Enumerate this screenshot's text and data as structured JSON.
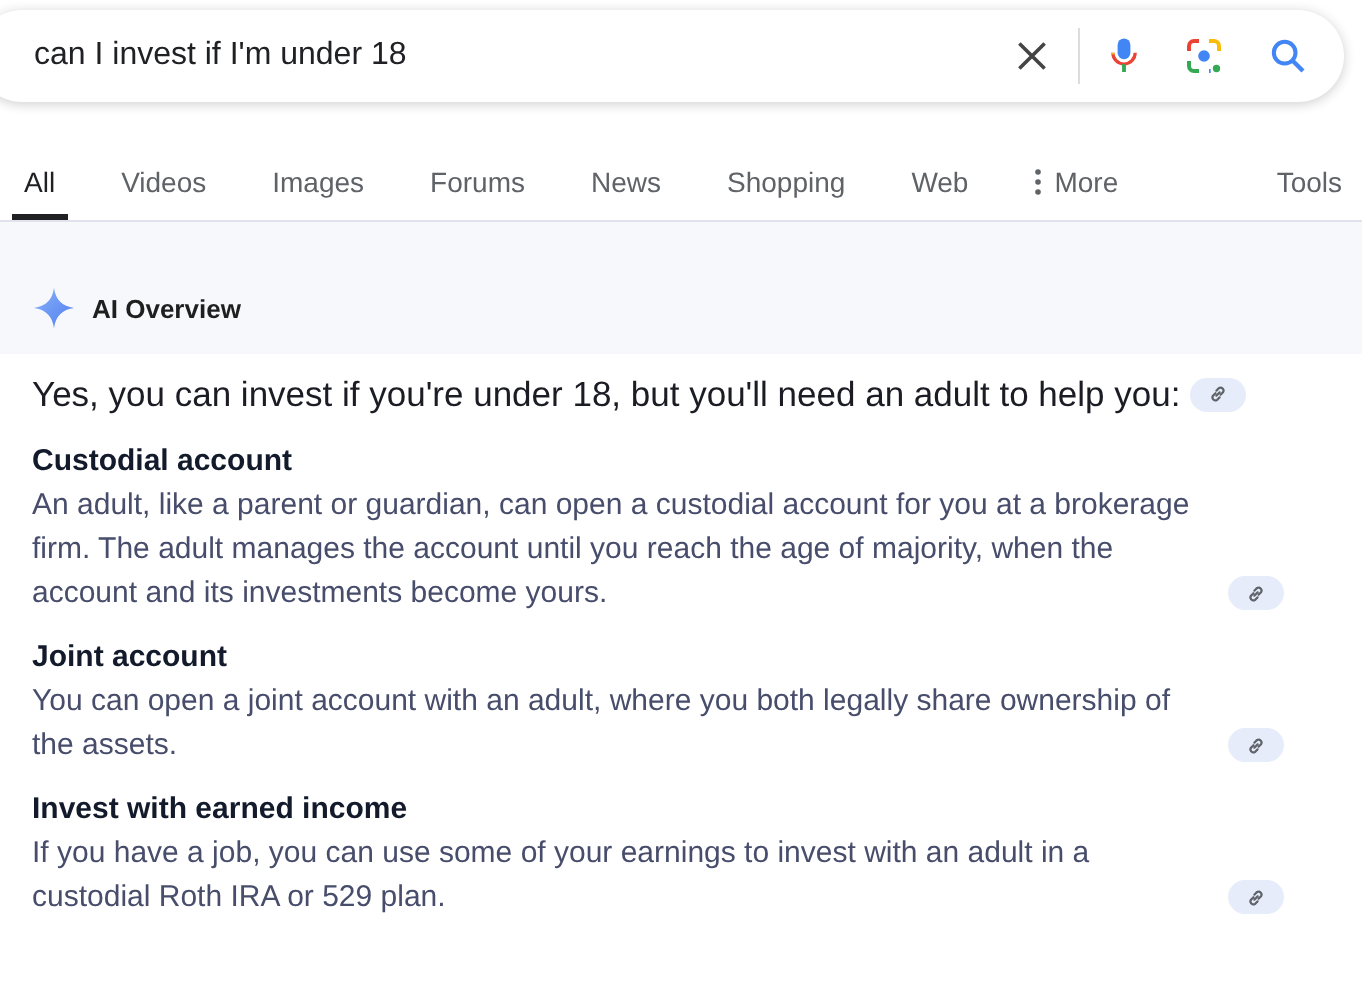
{
  "search": {
    "value": "can I invest if I'm under 18"
  },
  "tabs": [
    {
      "label": "All",
      "selected": true
    },
    {
      "label": "Videos",
      "selected": false
    },
    {
      "label": "Images",
      "selected": false
    },
    {
      "label": "Forums",
      "selected": false
    },
    {
      "label": "News",
      "selected": false
    },
    {
      "label": "Shopping",
      "selected": false
    },
    {
      "label": "Web",
      "selected": false
    },
    {
      "label": "More",
      "selected": false,
      "kind": "menu"
    }
  ],
  "tools": "Tools",
  "overview": {
    "title": "AI Overview",
    "summary": "Yes, you can invest if you're under 18, but you'll need an adult to help you:",
    "sections": [
      {
        "heading": "Custodial account",
        "text": "An adult, like a parent or guardian, can open a custodial account for you at a brokerage firm. The adult manages the account until you reach the age of majority, when the account and its investments become yours."
      },
      {
        "heading": "Joint account",
        "text": "You can open a joint account with an adult, where you both legally share ownership of the assets."
      },
      {
        "heading": "Invest with earned income",
        "text": "If you have a job, you can use some of your earnings to invest with an adult in a custodial Roth IRA or 529 plan."
      }
    ]
  }
}
